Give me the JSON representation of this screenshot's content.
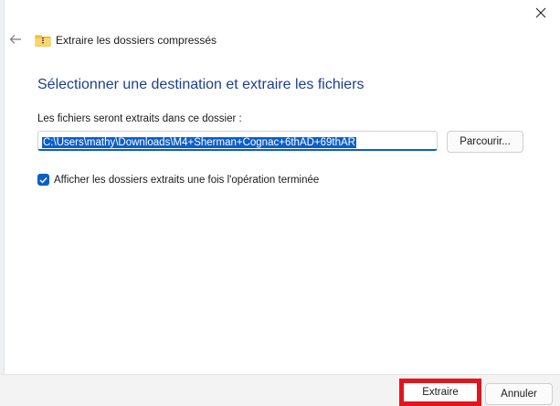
{
  "window": {
    "title": "Extraire les dossiers compressés",
    "close_icon": "close-icon",
    "back_icon": "arrow-left-icon",
    "folder_icon": "zip-folder-icon"
  },
  "main": {
    "heading": "Sélectionner une destination et extraire les fichiers",
    "destination_label": "Les fichiers seront extraits dans ce dossier :",
    "destination_path": "C:\\Users\\mathy\\Downloads\\M4+Sherman+Cognac+6thAD+69thAR",
    "browse_label": "Parcourir...",
    "show_extracted_checked": true,
    "show_extracted_label": "Afficher les dossiers extraits une fois l'opération terminée"
  },
  "footer": {
    "extract_label": "Extraire",
    "cancel_label": "Annuler",
    "highlight_color": "#e2141c"
  },
  "colors": {
    "accent": "#0a5fc9",
    "heading": "#1d3f8c"
  }
}
